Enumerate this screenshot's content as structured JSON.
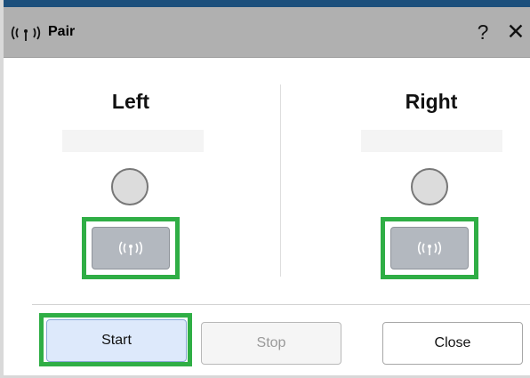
{
  "window": {
    "title": "Pair",
    "help_glyph": "?",
    "close_glyph": "✕"
  },
  "left": {
    "title": "Left",
    "status_text": ""
  },
  "right": {
    "title": "Right",
    "status_text": ""
  },
  "icons": {
    "title": "wireless-signal-icon",
    "left_pair": "wireless-signal-icon",
    "right_pair": "wireless-signal-icon"
  },
  "buttons": {
    "start": "Start",
    "stop": "Stop",
    "close": "Close"
  },
  "colors": {
    "highlight_frame": "#2fae45",
    "start_button_fill": "#dde9fb",
    "pair_button_fill": "#b3b8bf",
    "titlebar": "#b0b0b0"
  }
}
